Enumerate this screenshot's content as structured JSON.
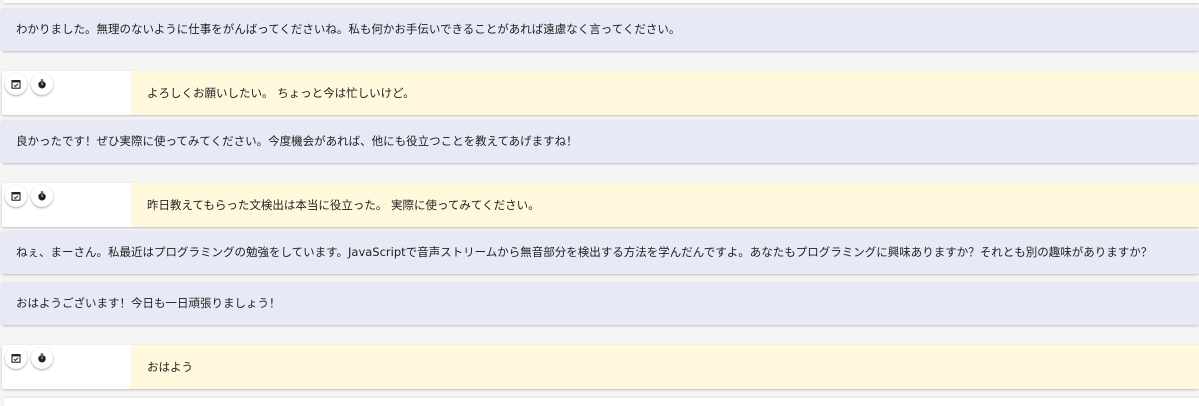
{
  "messages": [
    {
      "role": "assistant",
      "text": "わかりました。無理のないように仕事をがんばってくださいね。私も何かお手伝いできることがあれば遠慮なく言ってください。"
    },
    {
      "role": "user",
      "text": "よろしくお願いしたい。 ちょっと今は忙しいけど。",
      "icons": [
        "calendar-icon",
        "timer-icon"
      ]
    },
    {
      "role": "assistant",
      "text": "良かったです！ぜひ実際に使ってみてください。今度機会があれば、他にも役立つことを教えてあげますね！"
    },
    {
      "role": "user",
      "text": "昨日教えてもらった文検出は本当に役立った。 実際に使ってみてください。",
      "icons": [
        "calendar-icon",
        "timer-icon"
      ]
    },
    {
      "role": "assistant",
      "text": "ねぇ、まーさん。私最近はプログラミングの勉強をしています。JavaScriptで音声ストリームから無音部分を検出する方法を学んだんですよ。あなたもプログラミングに興味ありますか？それとも別の趣味がありますか？"
    },
    {
      "role": "assistant",
      "text": "おはようございます！今日も一日頑張りましょう！"
    },
    {
      "role": "user",
      "text": "おはよう",
      "icons": [
        "calendar-icon",
        "timer-icon"
      ]
    }
  ]
}
